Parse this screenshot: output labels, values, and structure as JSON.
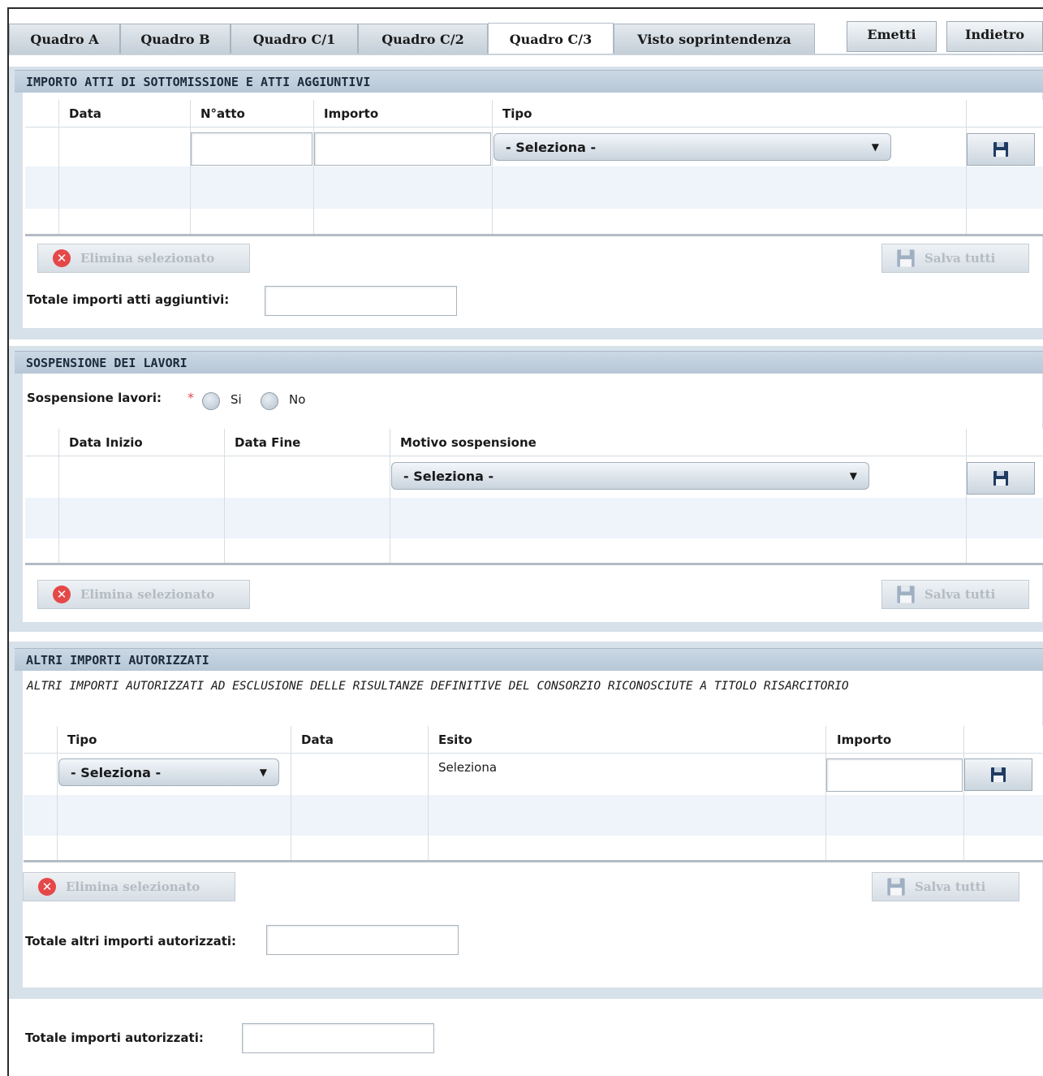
{
  "tabs": [
    "Quadro A",
    "Quadro B",
    "Quadro C/1",
    "Quadro C/2",
    "Quadro C/3",
    "Visto soprintendenza"
  ],
  "actions": {
    "emit": "Emetti",
    "back": "Indietro"
  },
  "section1": {
    "title": "IMPORTO ATTI DI SOTTOMISSIONE E ATTI AGGIUNTIVI",
    "columns": [
      "Data",
      "N°atto",
      "Importo",
      "Tipo"
    ],
    "select": "- Seleziona -",
    "delete_label": "Elimina selezionato",
    "saveall_label": "Salva tutti",
    "total_label": "Totale importi atti aggiuntivi:"
  },
  "section2": {
    "title": "SOSPENSIONE DEI LAVORI",
    "suspension_label": "Sospensione lavori:",
    "required_mark": "*",
    "opt_yes": "Si",
    "opt_no": "No",
    "columns": [
      "Data Inizio",
      "Data Fine",
      "Motivo sospensione"
    ],
    "select": "- Seleziona -",
    "delete_label": "Elimina selezionato",
    "saveall_label": "Salva tutti"
  },
  "section3": {
    "title": "ALTRI IMPORTI AUTORIZZATI",
    "description": "ALTRI IMPORTI AUTORIZZATI AD ESCLUSIONE DELLE RISULTANZE DEFINITIVE DEL CONSORZIO RICONOSCIUTE A TITOLO RISARCITORIO",
    "columns": [
      "Tipo",
      "Data",
      "Esito",
      "Importo"
    ],
    "select": "- Seleziona -",
    "esito_value": "Seleziona",
    "delete_label": "Elimina selezionato",
    "saveall_label": "Salva tutti",
    "total_label": "Totale altri importi autorizzati:"
  },
  "grand_total_label": "Totale importi autorizzati:"
}
